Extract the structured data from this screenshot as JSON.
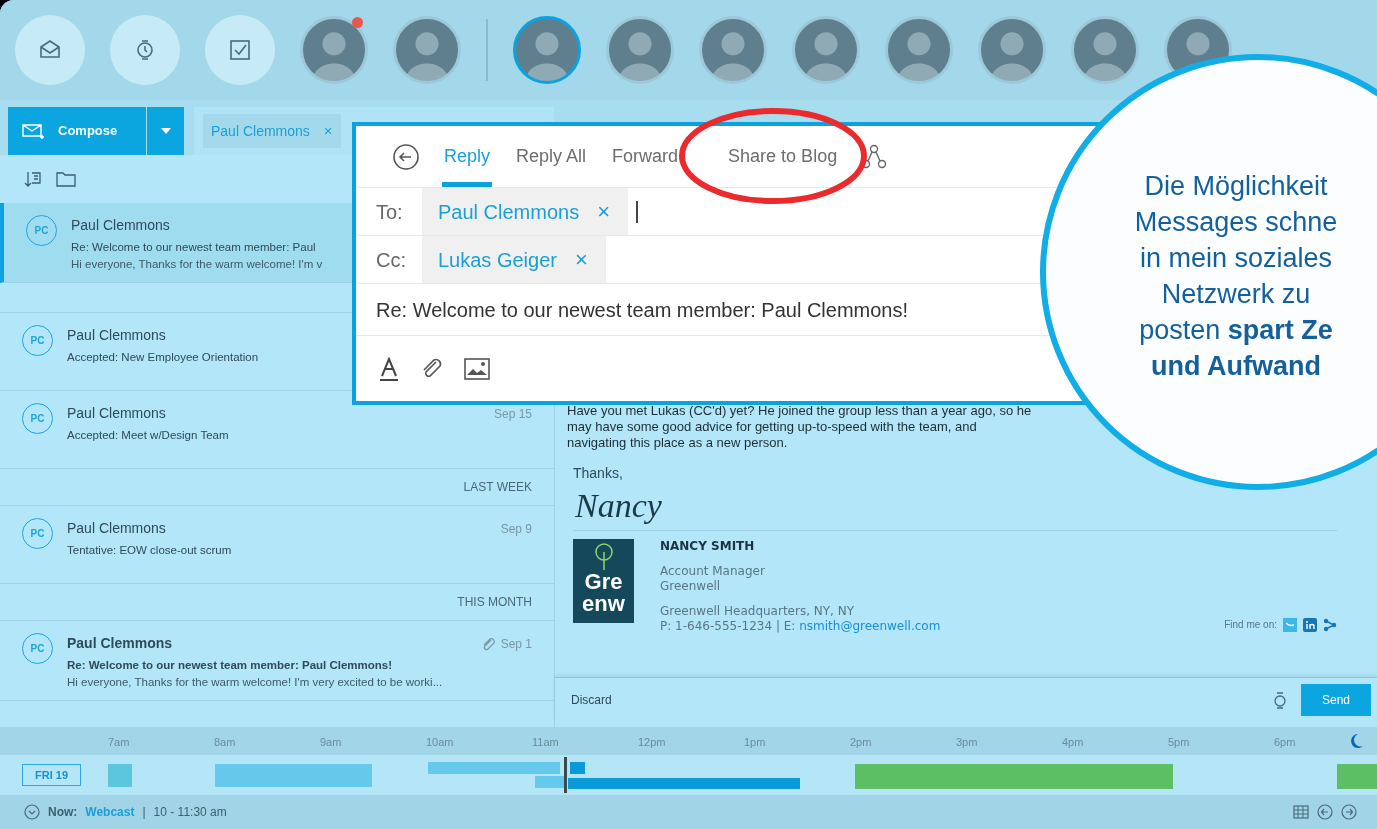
{
  "favorites": [
    {
      "notification": true,
      "selected": false
    },
    {
      "notification": false,
      "selected": false
    }
  ],
  "contacts": [
    {
      "notification": false,
      "selected": true
    },
    {
      "notification": false,
      "selected": false
    },
    {
      "notification": false,
      "selected": false
    },
    {
      "notification": false,
      "selected": false
    },
    {
      "notification": false,
      "selected": false
    },
    {
      "notification": false,
      "selected": false
    },
    {
      "notification": false,
      "selected": false
    },
    {
      "notification": false,
      "selected": false
    }
  ],
  "compose": {
    "label": "Compose"
  },
  "open_tabs": [
    {
      "label": "Paul Clemmons",
      "close": "×"
    }
  ],
  "message_list": [
    {
      "kind": "message",
      "initials": "PC",
      "sender": "Paul Clemmons",
      "subject": "Re: Welcome to our newest team member: Paul",
      "preview": "Hi everyone, Thanks for the warm welcome! I'm v",
      "selected": true,
      "unread": false,
      "attachment": false
    },
    {
      "kind": "spacer"
    },
    {
      "kind": "message",
      "initials": "PC",
      "sender": "Paul Clemmons",
      "subject": "Accepted: New Employee Orientation",
      "selected": false,
      "unread": false,
      "attachment": false
    },
    {
      "kind": "message",
      "initials": "PC",
      "sender": "Paul Clemmons",
      "date": "Sep 15",
      "subject": "Accepted: Meet w/Design Team",
      "selected": false,
      "unread": false,
      "attachment": false
    },
    {
      "kind": "header",
      "label": "LAST WEEK"
    },
    {
      "kind": "message",
      "initials": "PC",
      "sender": "Paul Clemmons",
      "date": "Sep 9",
      "subject": "Tentative: EOW close-out scrum",
      "selected": false,
      "unread": false,
      "attachment": false
    },
    {
      "kind": "header",
      "label": "THIS MONTH"
    },
    {
      "kind": "message",
      "initials": "PC",
      "sender": "Paul Clemmons",
      "date": "Sep 1",
      "subject": "Re: Welcome to our newest team member: Paul Clemmons!",
      "preview": "Hi everyone, Thanks for the warm welcome! I'm very excited to be worki...",
      "selected": false,
      "unread": true,
      "attachment": true
    }
  ],
  "reply": {
    "actions": [
      {
        "label": "Reply",
        "selected": true
      },
      {
        "label": "Reply All",
        "selected": false
      },
      {
        "label": "Forward",
        "selected": false
      },
      {
        "label": "Share to Blog",
        "selected": false,
        "highlighted": true
      }
    ],
    "to_label": "To:",
    "to": [
      {
        "name": "Paul Clemmons",
        "remove": "×"
      }
    ],
    "cc_label": "Cc:",
    "cc": [
      {
        "name": "Lukas Geiger",
        "remove": "×"
      }
    ],
    "subject": "Re: Welcome to our newest team member: Paul Clemmons!"
  },
  "message": {
    "body": "Have you met Lukas (CC'd) yet? He joined the group less than a year ago, so he may have some good advice for getting up-to-speed with the team, and navigating this place as a new person.",
    "closing": "Thanks,",
    "signature_script": "Nancy",
    "name": "NANCY SMITH",
    "title": "Account Manager",
    "company": "Greenwell",
    "address": "Greenwell Headquarters, NY, NY",
    "phone": "P: 1-646-555-1234 | E: ",
    "email": "nsmith@greenwell.com",
    "logo_lines": [
      "Gre",
      "enw"
    ],
    "find_me": "Find me on:"
  },
  "compose_footer": {
    "discard": "Discard",
    "send": "Send"
  },
  "timeline": {
    "hours": [
      "7am",
      "8am",
      "9am",
      "10am",
      "11am",
      "12pm",
      "1pm",
      "2pm",
      "3pm",
      "4pm",
      "5pm",
      "6pm"
    ],
    "day": "FRI 19"
  },
  "status_bar": {
    "now_label": "Now:",
    "event": "Webcast",
    "separator": "|",
    "time": "10 - 11:30 am"
  },
  "callout": {
    "lines": [
      "Die Möglichkeit",
      "Messages schne",
      "in mein soziales",
      "Netzwerk zu",
      "posten **spart Ze**",
      "**und Aufwand**"
    ]
  }
}
